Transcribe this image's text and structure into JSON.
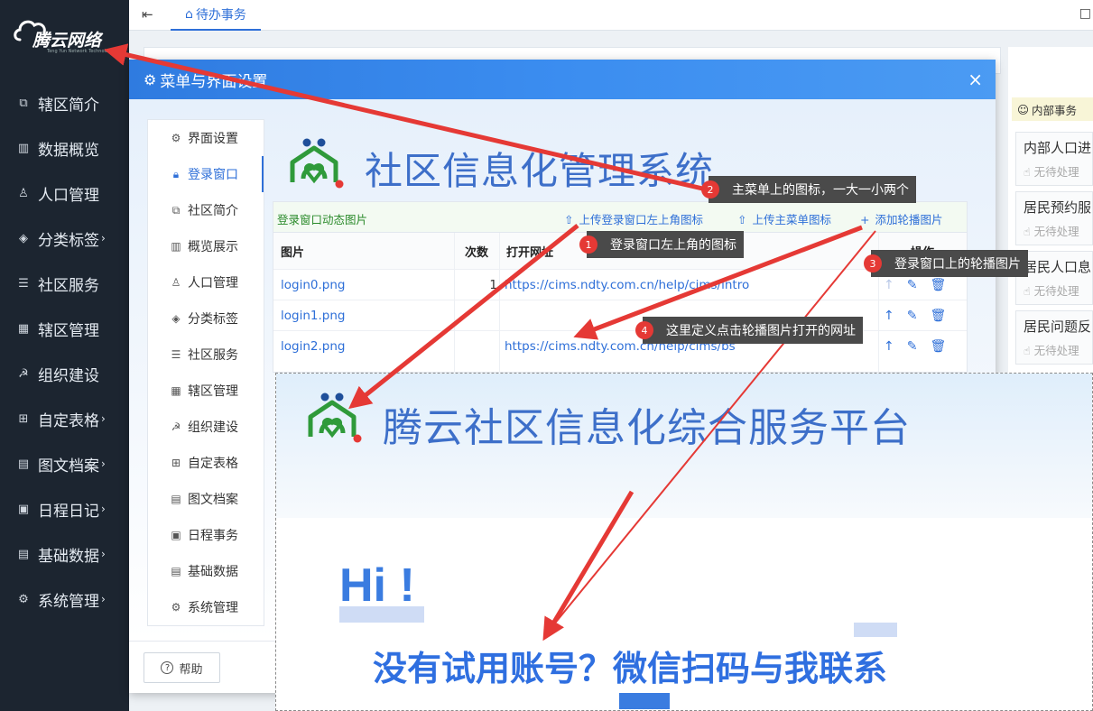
{
  "brand": {
    "name": "腾云网络",
    "tagline": "Teng Yun Network Technology"
  },
  "sidebar": {
    "items": [
      {
        "label": "辖区简介",
        "icon": "copy-icon",
        "arrow": ""
      },
      {
        "label": "数据概览",
        "icon": "bar-chart-icon",
        "arrow": ""
      },
      {
        "label": "人口管理",
        "icon": "user-icon",
        "arrow": ""
      },
      {
        "label": "分类标签",
        "icon": "tag-icon",
        "arrow": "›"
      },
      {
        "label": "社区服务",
        "icon": "list-icon",
        "arrow": ""
      },
      {
        "label": "辖区管理",
        "icon": "grid-icon",
        "arrow": ""
      },
      {
        "label": "组织建设",
        "icon": "hammer-sickle-icon",
        "arrow": ""
      },
      {
        "label": "自定表格",
        "icon": "table-icon",
        "arrow": "›"
      },
      {
        "label": "图文档案",
        "icon": "document-icon",
        "arrow": "›"
      },
      {
        "label": "日程日记",
        "icon": "calendar-icon",
        "arrow": "›"
      },
      {
        "label": "基础数据",
        "icon": "database-icon",
        "arrow": "›"
      },
      {
        "label": "系统管理",
        "icon": "gear-icon",
        "arrow": "›"
      }
    ]
  },
  "topbar": {
    "tab_label": "待办事务"
  },
  "right_panel": {
    "header": "内部事务",
    "cards": [
      {
        "title": "内部人口进",
        "status": "无待处理"
      },
      {
        "title": "居民预约服",
        "status": "无待处理"
      },
      {
        "title": "居民人口息",
        "status": "无待处理"
      },
      {
        "title": "居民问题反",
        "status": "无待处理"
      }
    ]
  },
  "dialog": {
    "title": "菜单与界面设置",
    "close": "×",
    "help": "帮助",
    "menu": [
      {
        "label": "界面设置",
        "icon": "gear-icon"
      },
      {
        "label": "登录窗口",
        "icon": "lock-icon",
        "active": true
      },
      {
        "label": "社区简介",
        "icon": "copy-icon"
      },
      {
        "label": "概览展示",
        "icon": "bar-chart-icon"
      },
      {
        "label": "人口管理",
        "icon": "user-icon"
      },
      {
        "label": "分类标签",
        "icon": "tag-icon"
      },
      {
        "label": "社区服务",
        "icon": "list-icon"
      },
      {
        "label": "辖区管理",
        "icon": "grid-icon"
      },
      {
        "label": "组织建设",
        "icon": "hammer-sickle-icon"
      },
      {
        "label": "自定表格",
        "icon": "table-icon"
      },
      {
        "label": "图文档案",
        "icon": "document-icon"
      },
      {
        "label": "日程事务",
        "icon": "calendar-icon"
      },
      {
        "label": "基础数据",
        "icon": "database-icon"
      },
      {
        "label": "系统管理",
        "icon": "gear-icon"
      }
    ],
    "system_title": "社区信息化管理系统",
    "table": {
      "toolbar_title": "登录窗口动态图片",
      "btn_upload_login_icon": "上传登录窗口左上角图标",
      "btn_upload_menu_icon": "上传主菜单图标",
      "btn_add_carousel": "添加轮播图片",
      "columns": {
        "image": "图片",
        "count": "次数",
        "url": "打开网址",
        "ops": "操作"
      },
      "rows": [
        {
          "file": "login0.png",
          "count": "1",
          "url": "https://cims.ndty.com.cn/help/cims/intro"
        },
        {
          "file": "login1.png",
          "count": "",
          "url": ""
        },
        {
          "file": "login2.png",
          "count": "",
          "url": "https://cims.ndty.com.cn/help/cims/bs"
        }
      ]
    }
  },
  "login_preview": {
    "title": "腾云社区信息化综合服务平台",
    "greeting": "Hi !"
  },
  "callouts": [
    {
      "num": "1",
      "text": "登录窗口左上角的图标"
    },
    {
      "num": "2",
      "text": "主菜单上的图标，一大一小两个"
    },
    {
      "num": "3",
      "text": "登录窗口上的轮播图片"
    },
    {
      "num": "4",
      "text": "这里定义点击轮播图片打开的网址"
    }
  ],
  "promo": "没有试用账号？微信扫码与我联系",
  "colors": {
    "sidebar_bg": "#1c2530",
    "accent": "#2e6fd8",
    "annotation_red": "#e53935",
    "callout_bg": "#4a4a4a"
  }
}
